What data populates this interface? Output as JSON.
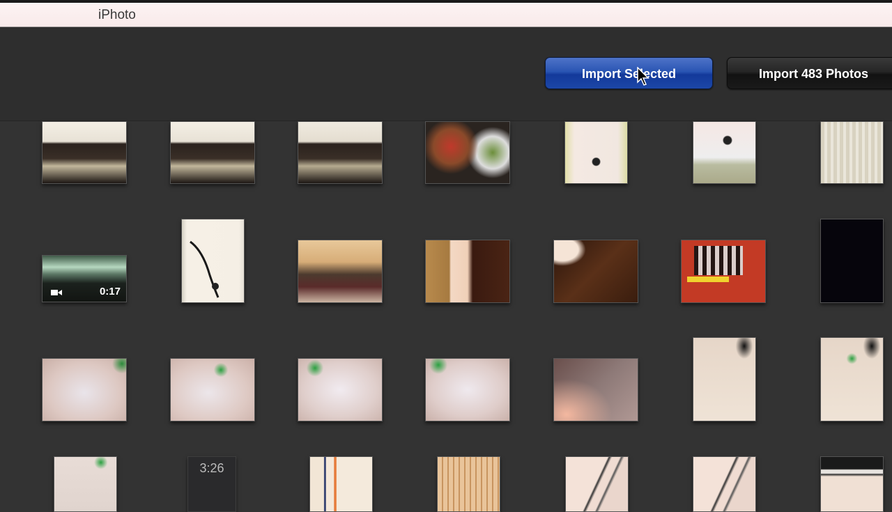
{
  "menubar": {
    "app_name": "iPhoto"
  },
  "toolbar": {
    "import_selected_label": "Import Selected",
    "import_all_label": "Import 483 Photos",
    "primary_color": "#2a55b3"
  },
  "thumbnails": [
    {
      "row": 1,
      "col": 1,
      "kind": "photo",
      "subject": "group dinner at restaurant"
    },
    {
      "row": 1,
      "col": 2,
      "kind": "photo",
      "subject": "group dinner at restaurant"
    },
    {
      "row": 1,
      "col": 3,
      "kind": "photo",
      "subject": "group dinner at restaurant"
    },
    {
      "row": 1,
      "col": 4,
      "kind": "photo",
      "subject": "food dishes on table"
    },
    {
      "row": 1,
      "col": 5,
      "kind": "photo",
      "subject": "paper document"
    },
    {
      "row": 1,
      "col": 6,
      "kind": "photo",
      "subject": "paper on table"
    },
    {
      "row": 1,
      "col": 7,
      "kind": "photo",
      "subject": "printed page"
    },
    {
      "row": 2,
      "col": 1,
      "kind": "video",
      "subject": "cloudy sky",
      "duration": "0:17"
    },
    {
      "row": 2,
      "col": 2,
      "kind": "photo",
      "subject": "wall sculpture"
    },
    {
      "row": 2,
      "col": 3,
      "kind": "photo",
      "subject": "group photo in living room"
    },
    {
      "row": 2,
      "col": 4,
      "kind": "photo",
      "subject": "dark wooden floor"
    },
    {
      "row": 2,
      "col": 5,
      "kind": "photo",
      "subject": "dark wooden floor"
    },
    {
      "row": 2,
      "col": 6,
      "kind": "photo",
      "subject": "game board on red table"
    },
    {
      "row": 2,
      "col": 7,
      "kind": "photo",
      "subject": "black frame"
    },
    {
      "row": 3,
      "col": 1,
      "kind": "photo",
      "subject": "cables on table"
    },
    {
      "row": 3,
      "col": 2,
      "kind": "photo",
      "subject": "cables on table"
    },
    {
      "row": 3,
      "col": 3,
      "kind": "photo",
      "subject": "cables on table"
    },
    {
      "row": 3,
      "col": 4,
      "kind": "photo",
      "subject": "cables on table"
    },
    {
      "row": 3,
      "col": 5,
      "kind": "photo",
      "subject": "cables on table"
    },
    {
      "row": 3,
      "col": 6,
      "kind": "photo",
      "subject": "cables on table"
    },
    {
      "row": 3,
      "col": 7,
      "kind": "photo",
      "subject": "cables on table"
    },
    {
      "row": 4,
      "col": 1,
      "kind": "photo",
      "subject": "cables on table"
    },
    {
      "row": 4,
      "col": 2,
      "kind": "photo",
      "subject": "phone lock screen",
      "lock_time": "3:26"
    },
    {
      "row": 4,
      "col": 3,
      "kind": "photo",
      "subject": "box with text"
    },
    {
      "row": 4,
      "col": 4,
      "kind": "photo",
      "subject": "window blinds"
    },
    {
      "row": 4,
      "col": 5,
      "kind": "photo",
      "subject": "abstract lines"
    },
    {
      "row": 4,
      "col": 6,
      "kind": "photo",
      "subject": "abstract lines"
    },
    {
      "row": 4,
      "col": 7,
      "kind": "photo",
      "subject": "crossing bars"
    }
  ]
}
